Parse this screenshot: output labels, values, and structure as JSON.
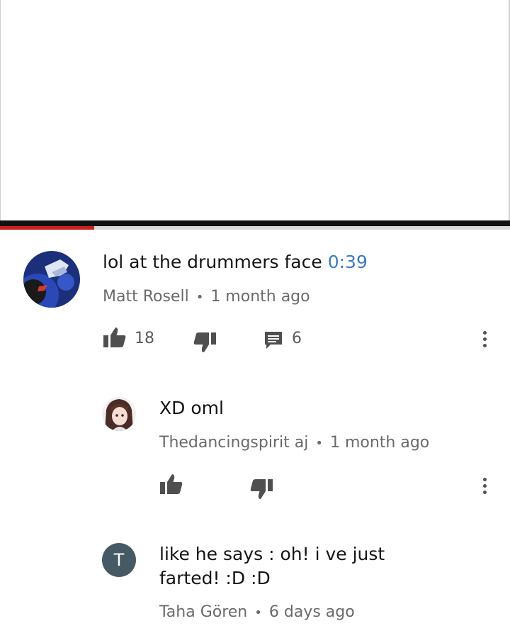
{
  "player": {
    "progress_fraction": 0.185
  },
  "comments": [
    {
      "text": "lol at the drummers face",
      "timestamp_link": "0:39",
      "author": "Matt Rosell",
      "separator": "•",
      "age": "1 month ago",
      "like_count": "18",
      "reply_count": "6"
    },
    {
      "text": "XD oml",
      "author": "Thedancingspirit aj",
      "separator": "•",
      "age": "1 month ago"
    },
    {
      "text": "like he says : oh! i ve just farted! :D :D",
      "avatar_letter": "T",
      "author": "Taha Gören",
      "separator": "•",
      "age": "6 days ago"
    }
  ],
  "icons": {
    "like": "thumbs-up-icon",
    "dislike": "thumbs-down-icon",
    "reply": "reply-comment-icon",
    "more": "more-vertical-icon"
  },
  "colors": {
    "progress": "#cc1f1f",
    "link": "#3b79c9",
    "letter_avatar": "#455a64"
  }
}
